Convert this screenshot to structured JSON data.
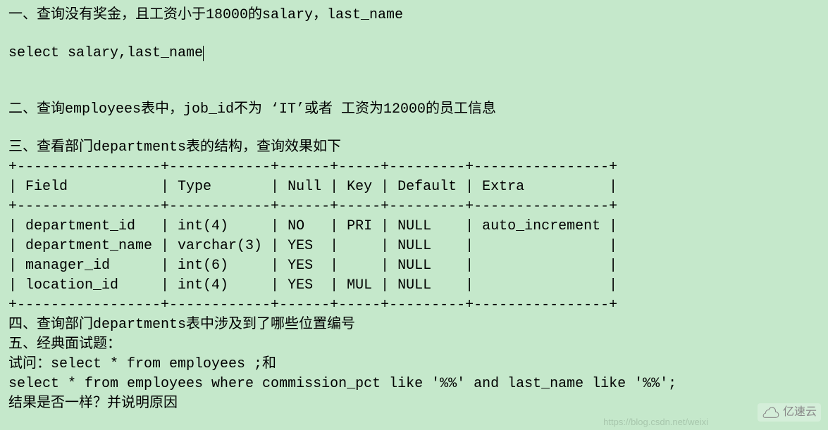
{
  "q1_title": "一、查询没有奖金，且工资小于18000的salary，last_name",
  "q1_sql": "select salary,last_name",
  "q2_title": "二、查询employees表中，job_id不为 ‘IT’或者 工资为12000的员工信息",
  "q3_title": "三、查看部门departments表的结构，查询效果如下",
  "table_border_top": "+-----------------+------------+------+-----+---------+----------------+",
  "table_header": "| Field           | Type       | Null | Key | Default | Extra          |",
  "table_border_mid": "+-----------------+------------+------+-----+---------+----------------+",
  "table_row1": "| department_id   | int(4)     | NO   | PRI | NULL    | auto_increment |",
  "table_row2": "| department_name | varchar(3) | YES  |     | NULL    |                |",
  "table_row3": "| manager_id      | int(6)     | YES  |     | NULL    |                |",
  "table_row4": "| location_id     | int(4)     | YES  | MUL | NULL    |                |",
  "table_border_bot": "+-----------------+------------+------+-----+---------+----------------+",
  "q4_title": "四、查询部门departments表中涉及到了哪些位置编号",
  "q5_title": "五、经典面试题：",
  "q5_line1": "试问：select * from employees ;和",
  "q5_line2": "select * from employees where commission_pct like '%%' and last_name like '%%';",
  "q5_line3": "结果是否一样？并说明原因",
  "chart_data": {
    "type": "table",
    "columns": [
      "Field",
      "Type",
      "Null",
      "Key",
      "Default",
      "Extra"
    ],
    "rows": [
      [
        "department_id",
        "int(4)",
        "NO",
        "PRI",
        "NULL",
        "auto_increment"
      ],
      [
        "department_name",
        "varchar(3)",
        "YES",
        "",
        "NULL",
        ""
      ],
      [
        "manager_id",
        "int(6)",
        "YES",
        "",
        "NULL",
        ""
      ],
      [
        "location_id",
        "int(4)",
        "YES",
        "MUL",
        "NULL",
        ""
      ]
    ]
  },
  "watermark_logo_text": "亿速云",
  "watermark_url": "https://blog.csdn.net/weixi"
}
